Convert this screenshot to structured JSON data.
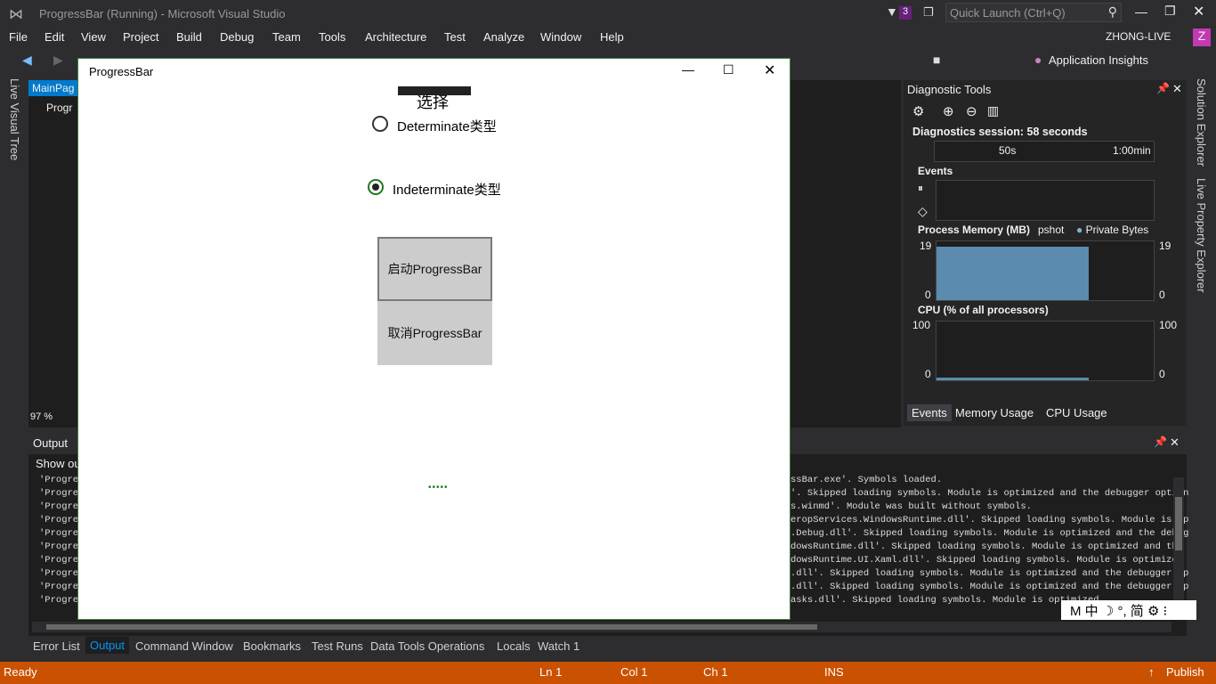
{
  "window": {
    "title": "ProgressBar (Running) - Microsoft Visual Studio",
    "notif_count": "3",
    "quick_launch_placeholder": "Quick Launch (Ctrl+Q)",
    "user": "ZHONG-LIVE",
    "user_initial": "Z"
  },
  "menu": [
    "File",
    "Edit",
    "View",
    "Project",
    "Build",
    "Debug",
    "Team",
    "Tools",
    "Architecture",
    "Test",
    "Analyze",
    "Window",
    "Help"
  ],
  "toolbar": {
    "insights": "Application Insights"
  },
  "side_panels": {
    "left": "Live Visual Tree",
    "right_1": "Solution Explorer",
    "right_2": "Live Property Explorer"
  },
  "editor": {
    "tab": "MainPag",
    "subtab": "Progr",
    "zoom": "97 %"
  },
  "app": {
    "title": "ProgressBar",
    "heading": "选择",
    "radio_determinate": "Determinate类型",
    "radio_indeterminate": "Indeterminate类型",
    "radio_selected": "indeterminate",
    "btn_start": "启动ProgressBar",
    "btn_cancel": "取消ProgressBar",
    "progress_dots": "•••••"
  },
  "diagnostics": {
    "title": "Diagnostic Tools",
    "session": "Diagnostics session: 58 seconds",
    "timeline_labels": [
      "50s",
      "1:00min"
    ],
    "events_label": "Events",
    "memory_label": "Process Memory (MB)",
    "memory_legend_1": "pshot",
    "memory_legend_2": "Private Bytes",
    "memory_max": "19",
    "memory_min": "0",
    "cpu_label": "CPU (% of all processors)",
    "cpu_max": "100",
    "cpu_min": "0",
    "tabs": [
      "Events",
      "Memory Usage",
      "CPU Usage"
    ]
  },
  "output": {
    "title": "Output",
    "show_label": "Show ou",
    "left_lines": [
      "'Progre",
      "'Progre",
      "'Progre",
      "'Progre",
      "'Progre",
      "'Progre",
      "'Progre",
      "'Progre",
      "'Progre",
      "'Progre"
    ],
    "right_lines": [
      "ssBar.exe'. Symbols loaded.",
      "'. Skipped loading symbols. Module is optimized and the debugger option",
      "s.winmd'. Module was built without symbols.",
      "eropServices.WindowsRuntime.dll'. Skipped loading symbols. Module is op",
      ".Debug.dll'. Skipped loading symbols. Module is optimized and the debug",
      "dowsRuntime.dll'. Skipped loading symbols. Module is optimized and the ",
      "dowsRuntime.UI.Xaml.dll'. Skipped loading symbols. Module is optimized ",
      ".dll'. Skipped loading symbols. Module is optimized and the debugger op",
      ".dll'. Skipped loading symbols. Module is optimized and the debugger op",
      "asks.dll'. Skipped loading symbols. Module is optimized"
    ]
  },
  "bottom_tabs": [
    "Error List",
    "Output",
    "Command Window",
    "Bookmarks",
    "Test Runs",
    "Data Tools Operations",
    "Locals",
    "Watch 1"
  ],
  "bottom_tab_active": "Output",
  "ime": "M 中 ☽ °, 简 ⚙ ⁝",
  "status": {
    "ready": "Ready",
    "ln": "Ln 1",
    "col": "Col 1",
    "ch": "Ch 1",
    "ins": "INS",
    "publish": "Publish"
  },
  "colors": {
    "accent": "#007acc",
    "status_bar": "#ca5100",
    "chart_fill": "#5b8cb0",
    "radio_selected": "#1e7a1e"
  }
}
